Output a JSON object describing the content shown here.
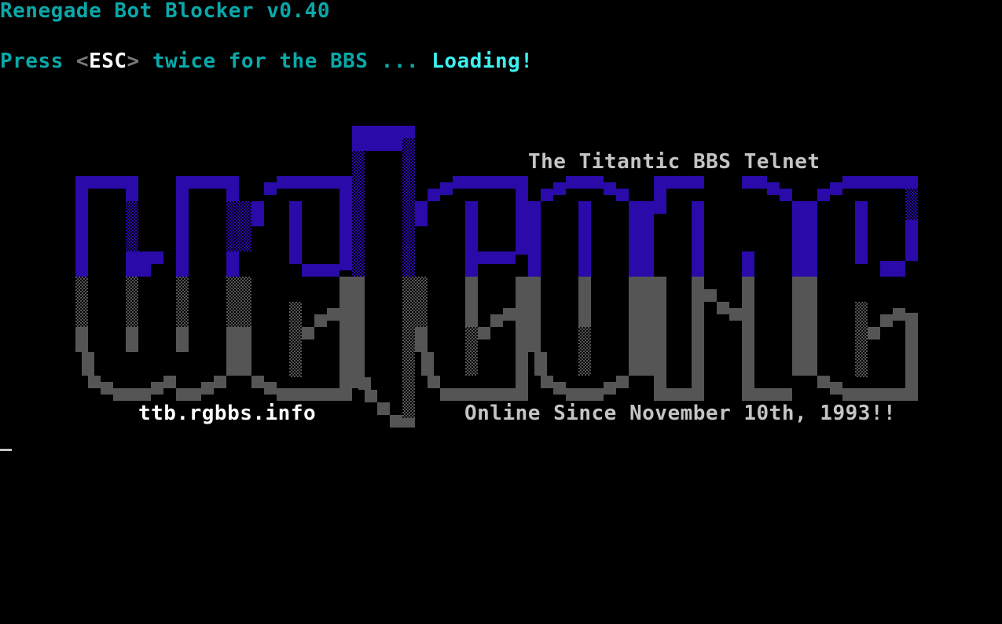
{
  "terminal": {
    "header": "Renegade Bot Blocker v0.40",
    "prompt": {
      "press": "Press ",
      "lt": "<",
      "key": "ESC",
      "gt": ">",
      "rest": " twice for the BBS ... ",
      "status": "Loading!"
    }
  },
  "banner": {
    "art_word": "welcome",
    "tagline": "The Titantic BBS Telnet",
    "url": "ttb.rgbbs.info",
    "since": "Online Since November 10th, 1993!!"
  },
  "colors": {
    "background": "#000000",
    "header_text": "#0aa8a8",
    "prompt_text": "#0aa8a8",
    "bright_cyan": "#3ef0f0",
    "white": "#ffffff",
    "logo_top": "#2a0aa8",
    "logo_bottom": "#555555",
    "light_gray": "#c4c4c4"
  }
}
